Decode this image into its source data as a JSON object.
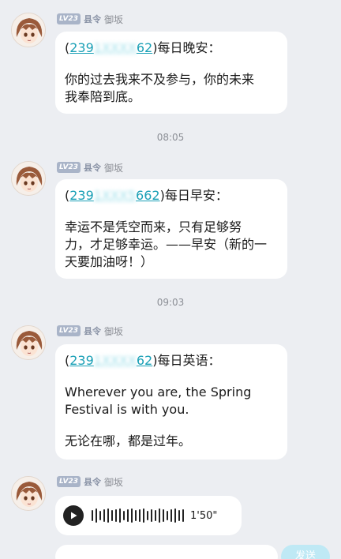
{
  "user": {
    "level": "LV23",
    "title": "县令",
    "nickname": "御坂"
  },
  "messages": [
    {
      "qq_prefix": "(",
      "qq_visible_start": "239",
      "qq_hidden": "1XXXX",
      "qq_visible_end": "62",
      "qq_suffix": ")",
      "heading": "每日晚安：",
      "body_lines": [
        "你的过去我来不及参与，你的未来",
        "我奉陪到底。"
      ]
    },
    {
      "qq_prefix": "(",
      "qq_visible_start": "239",
      "qq_hidden": "1XXX5",
      "qq_visible_end": "662",
      "qq_suffix": ")",
      "heading": "每日早安：",
      "body_lines": [
        "幸运不是凭空而来，只有足够努",
        "力，才足够幸运。——早安（新的一",
        "天要加油呀！）"
      ]
    },
    {
      "qq_prefix": "(",
      "qq_visible_start": "239",
      "qq_hidden": "1XXXX",
      "qq_visible_end": "62",
      "qq_suffix": ")",
      "heading": "每日英语：",
      "body_lines": [
        "Wherever you are, the Spring",
        "Festival is with you."
      ],
      "translation": "无论在哪，都是过年。"
    }
  ],
  "timestamps": [
    "08:05",
    "09:03"
  ],
  "voice": {
    "duration": "1'50\""
  },
  "send_label": "发送",
  "icons": [
    "avatar-icon",
    "play-icon",
    "waveform-icon"
  ]
}
